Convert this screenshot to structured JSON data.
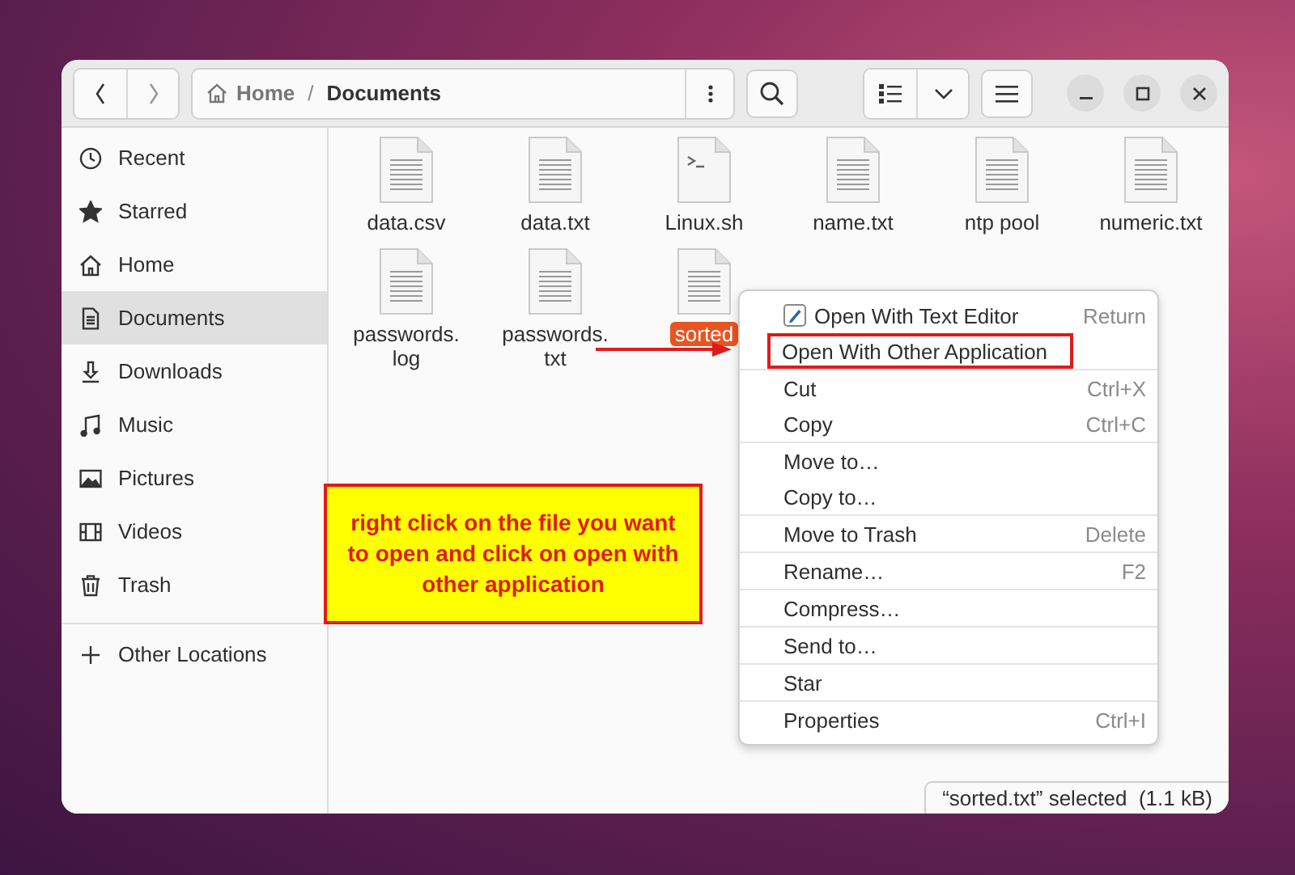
{
  "header": {
    "path": [
      {
        "label": "Home",
        "kind": "home"
      },
      {
        "label": "/",
        "kind": "separator"
      },
      {
        "label": "Documents",
        "kind": "current"
      }
    ]
  },
  "sidebar": {
    "items": [
      {
        "label": "Recent",
        "kind": "recent",
        "selected": false
      },
      {
        "label": "Starred",
        "kind": "star",
        "selected": false
      },
      {
        "label": "Home",
        "kind": "home",
        "selected": false
      },
      {
        "label": "Documents",
        "kind": "document",
        "selected": true
      },
      {
        "label": "Downloads",
        "kind": "download",
        "selected": false
      },
      {
        "label": "Music",
        "kind": "music",
        "selected": false
      },
      {
        "label": "Pictures",
        "kind": "picture",
        "selected": false
      },
      {
        "label": "Videos",
        "kind": "video",
        "selected": false
      },
      {
        "label": "Trash",
        "kind": "trash",
        "selected": false
      }
    ],
    "other": {
      "label": "Other Locations"
    }
  },
  "files": [
    {
      "name": "data.csv",
      "kind": "text",
      "selected": false
    },
    {
      "name": "data.txt",
      "kind": "text",
      "selected": false
    },
    {
      "name": "Linux.sh",
      "kind": "script",
      "selected": false
    },
    {
      "name": "name.txt",
      "kind": "text",
      "selected": false
    },
    {
      "name": "ntp pool",
      "kind": "text",
      "selected": false
    },
    {
      "name": "numeric.txt",
      "kind": "text",
      "selected": false
    },
    {
      "name": "passwords.\nlog",
      "kind": "text",
      "selected": false
    },
    {
      "name": "passwords.\ntxt",
      "kind": "text",
      "selected": false
    },
    {
      "name": "sorted",
      "kind": "text",
      "selected": true
    }
  ],
  "context_menu": {
    "groups": [
      [
        {
          "label": "Open With Text Editor",
          "shortcut": "Return",
          "kind": "editor",
          "annotated": false
        },
        {
          "label": "Open With Other Application",
          "annotated": true
        }
      ],
      [
        {
          "label": "Cut",
          "shortcut": "Ctrl+X",
          "annotated": false
        },
        {
          "label": "Copy",
          "shortcut": "Ctrl+C",
          "annotated": false
        }
      ],
      [
        {
          "label": "Move to…",
          "annotated": false
        },
        {
          "label": "Copy to…",
          "annotated": false
        }
      ],
      [
        {
          "label": "Move to Trash",
          "shortcut": "Delete",
          "annotated": false
        }
      ],
      [
        {
          "label": "Rename…",
          "shortcut": "F2",
          "annotated": false
        }
      ],
      [
        {
          "label": "Compress…",
          "annotated": false
        }
      ],
      [
        {
          "label": "Send to…",
          "annotated": false
        }
      ],
      [
        {
          "label": "Star",
          "annotated": false
        }
      ],
      [
        {
          "label": "Properties",
          "shortcut": "Ctrl+I",
          "annotated": false
        }
      ]
    ]
  },
  "annotation": {
    "text": "right click on the file you want to open and click on open with other application"
  },
  "status_bar": {
    "text": "“sorted.txt” selected  (1.1 kB)"
  }
}
